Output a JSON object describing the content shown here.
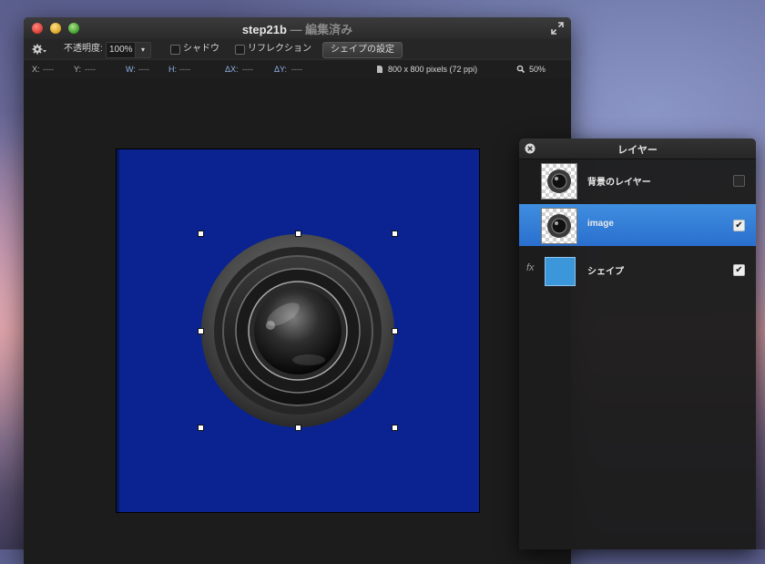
{
  "window": {
    "title": "step21b",
    "title_suffix": " — 編集済み"
  },
  "toolbar": {
    "opacity_label": "不透明度:",
    "opacity_value": "100%",
    "shadow_label": "シャドウ",
    "reflection_label": "リフレクション",
    "shape_settings_label": "シェイプの設定"
  },
  "infobar": {
    "x_label": "X:",
    "x_value": "----",
    "y_label": "Y:",
    "y_value": "----",
    "w_label": "W:",
    "w_value": "----",
    "h_label": "H:",
    "h_value": "----",
    "dx_label": "ΔX:",
    "dx_value": "----",
    "dy_label": "ΔY:",
    "dy_value": "----",
    "doc_size": "800 x 800 pixels (72 ppi)",
    "zoom": "50%"
  },
  "layers_panel": {
    "title": "レイヤー",
    "layers": [
      {
        "name": "背景のレイヤー",
        "visible": false,
        "selected": false
      },
      {
        "name": "image",
        "visible": true,
        "selected": true
      },
      {
        "name": "シェイプ",
        "visible": true,
        "selected": false,
        "fx": "fx"
      }
    ]
  },
  "colors": {
    "artboard": "#0a2390",
    "selection": "#2f7fd8",
    "shape_layer": "#3c96da"
  },
  "icons": [
    "close-icon",
    "minimize-icon",
    "zoom-icon",
    "fullscreen-icon",
    "gear-icon",
    "dropdown-arrow-icon",
    "document-icon",
    "magnifier-icon",
    "panel-close-icon",
    "checkbox-icon"
  ]
}
